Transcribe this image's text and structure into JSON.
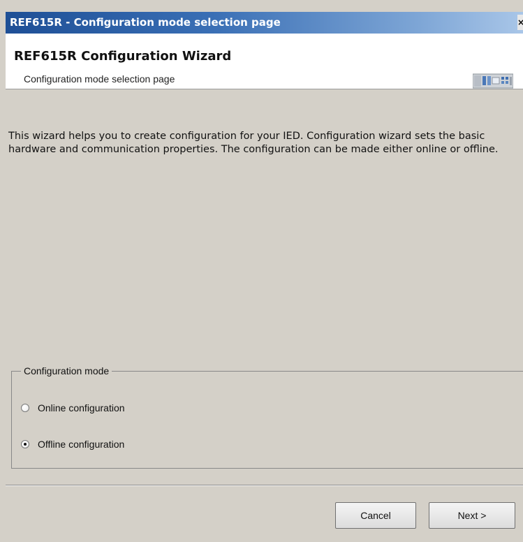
{
  "window": {
    "title": "REF615R - Configuration mode selection page",
    "close_glyph": "×"
  },
  "header": {
    "title": "REF615R Configuration Wizard",
    "subtitle": "Configuration mode selection page",
    "icon": "ied-device-icon"
  },
  "body": {
    "description": "This wizard helps you to create configuration for your IED. Configuration wizard sets the basic hardware and communication properties. The configuration can be made either online or offline."
  },
  "config_mode": {
    "group_label": "Configuration mode",
    "options": [
      {
        "label": "Online configuration",
        "checked": false
      },
      {
        "label": "Offline configuration",
        "checked": true
      }
    ]
  },
  "buttons": {
    "cancel_label": "Cancel",
    "next_label": "Next >"
  },
  "colors": {
    "titlebar_start": "#1e4f96",
    "dialog_bg": "#d4d0c8"
  }
}
